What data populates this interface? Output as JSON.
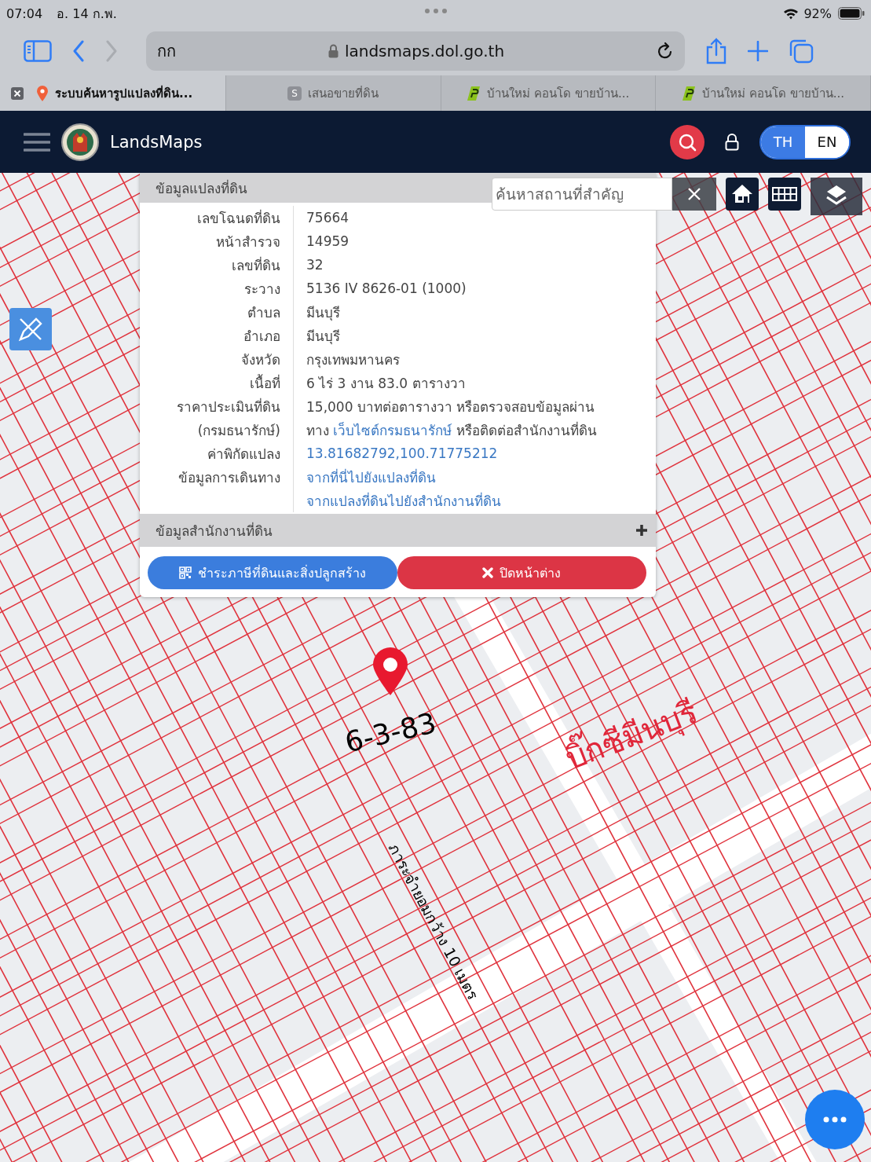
{
  "status_bar": {
    "time": "07:04",
    "date": "อ. 14 ก.พ.",
    "battery": "92%"
  },
  "browser": {
    "back": {
      "disabled": false
    },
    "forward": {
      "disabled": true
    },
    "text_size": "กก",
    "url": "landsmaps.dol.go.th"
  },
  "tabs": [
    {
      "title": "ระบบค้นหารูปแปลงที่ดิน...",
      "selected": true,
      "favicon": {
        "kind": "pin"
      }
    },
    {
      "title": "เสนอขายที่ดิน",
      "selected": false,
      "favicon": {
        "kind": "letter",
        "letter": "S"
      }
    },
    {
      "title": "บ้านใหม่ คอนโด ขายบ้าน...",
      "selected": false,
      "favicon": {
        "kind": "logo"
      }
    },
    {
      "title": "บ้านใหม่ คอนโด ขายบ้าน...",
      "selected": false,
      "favicon": {
        "kind": "logo"
      }
    }
  ],
  "header": {
    "brand": "LandsMaps",
    "languages": [
      {
        "label": "TH",
        "selected": true
      },
      {
        "label": "EN",
        "selected": false
      }
    ]
  },
  "map": {
    "search": {
      "placeholder": "ค้นหาสถานที่สำคัญ"
    },
    "annotations": [
      {
        "text": "6-3-83",
        "kind": "parcel"
      },
      {
        "text": "บิ๊กซีมีนบุรี",
        "kind": "place"
      },
      {
        "text": "ภาระจำยอมกว้าง 10 เมตร",
        "kind": "road"
      }
    ]
  },
  "popup": {
    "title": "ข้อมูลแปลงที่ดิน",
    "rows": [
      {
        "label": "เลขโฉนดที่ดิน",
        "value": [
          {
            "kind": "text",
            "text": "75664"
          }
        ]
      },
      {
        "label": "หน้าสำรวจ",
        "value": [
          {
            "kind": "text",
            "text": "14959"
          }
        ]
      },
      {
        "label": "เลขที่ดิน",
        "value": [
          {
            "kind": "text",
            "text": "32"
          }
        ]
      },
      {
        "label": "ระวาง",
        "value": [
          {
            "kind": "text",
            "text": "5136 IV 8626-01 (1000)"
          }
        ]
      },
      {
        "label": "ตำบล",
        "value": [
          {
            "kind": "text",
            "text": "มีนบุรี"
          }
        ]
      },
      {
        "label": "อำเภอ",
        "value": [
          {
            "kind": "text",
            "text": "มีนบุรี"
          }
        ]
      },
      {
        "label": "จังหวัด",
        "value": [
          {
            "kind": "text",
            "text": "กรุงเทพมหานคร"
          }
        ]
      },
      {
        "label": "เนื้อที่",
        "value": [
          {
            "kind": "text",
            "text": "6 ไร่ 3 งาน 83.0 ตารางวา"
          }
        ]
      },
      {
        "label": "ราคาประเมินที่ดิน",
        "value": [
          {
            "kind": "text",
            "text": "15,000 บาทต่อตารางวา หรือตรวจสอบข้อมูลผ่าน"
          }
        ]
      },
      {
        "label": "(กรมธนารักษ์)",
        "value": [
          {
            "kind": "text",
            "text": "ทาง "
          },
          {
            "kind": "link",
            "text": "เว็บไซต์กรมธนารักษ์"
          },
          {
            "kind": "text",
            "text": " หรือติดต่อสำนักงานที่ดิน"
          }
        ]
      },
      {
        "label": "ค่าพิกัดแปลง",
        "value": [
          {
            "kind": "link",
            "text": "13.81682792,100.71775212"
          }
        ]
      },
      {
        "label": "ข้อมูลการเดินทาง",
        "value": [
          {
            "kind": "link",
            "text": "จากที่นี่ไปยังแปลงที่ดิน"
          }
        ]
      },
      {
        "value": [
          {
            "kind": "link",
            "text": "จากแปลงที่ดินไปยังสำนักงานที่ดิน"
          }
        ]
      }
    ],
    "sections": [
      {
        "title": "ข้อมูลสำนักงานที่ดิน",
        "expanded": false
      }
    ],
    "buttons": [
      {
        "label": "ชำระภาษีที่ดินและสิ่งปลูกสร้าง",
        "kind": "pay"
      },
      {
        "label": "ปิดหน้าต่าง",
        "kind": "close"
      }
    ]
  }
}
